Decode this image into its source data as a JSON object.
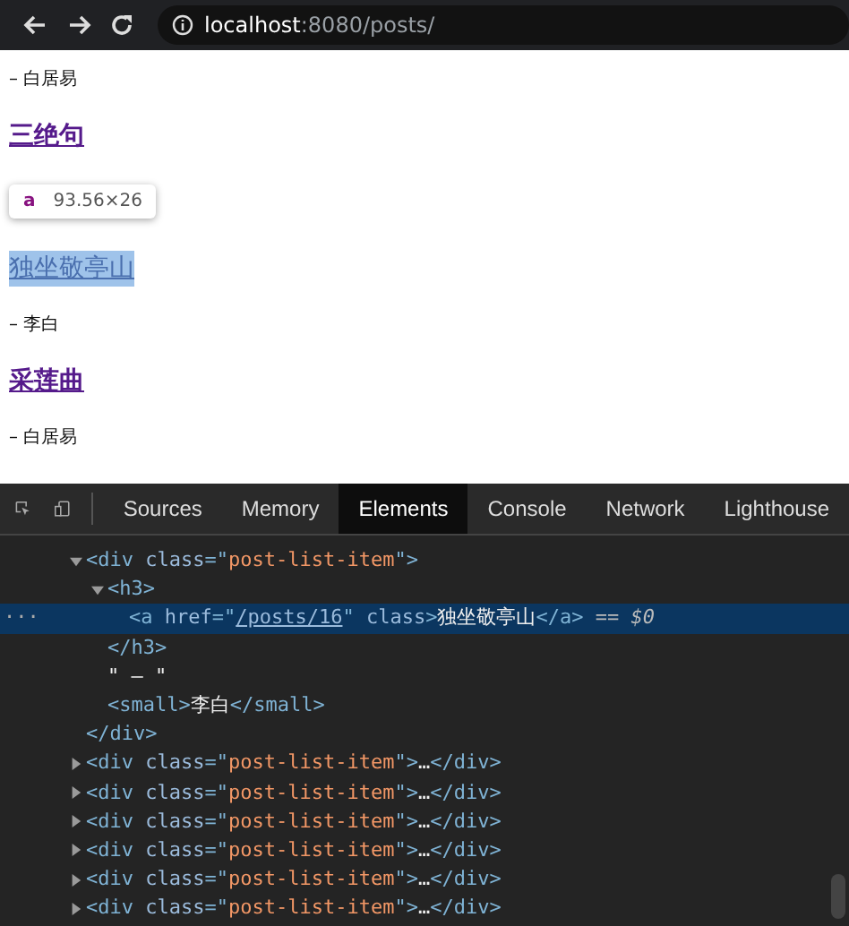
{
  "browser": {
    "url_host": "localhost",
    "url_path": ":8080/posts/"
  },
  "page": {
    "items": [
      {
        "kind": "author",
        "text": "– 白居易"
      },
      {
        "kind": "title",
        "text": "三绝句",
        "highlighted": false
      },
      {
        "kind": "title",
        "text": "独坐敬亭山",
        "highlighted": true
      },
      {
        "kind": "author",
        "text": "– 李白"
      },
      {
        "kind": "title",
        "text": "采莲曲",
        "highlighted": false
      },
      {
        "kind": "author",
        "text": "– 白居易"
      }
    ],
    "tooltip": {
      "tag": "a",
      "size": "93.56×26"
    }
  },
  "devtools": {
    "tabs": [
      {
        "label": "Sources",
        "selected": false
      },
      {
        "label": "Memory",
        "selected": false
      },
      {
        "label": "Elements",
        "selected": true
      },
      {
        "label": "Console",
        "selected": false
      },
      {
        "label": "Network",
        "selected": false
      },
      {
        "label": "Lighthouse",
        "selected": false
      }
    ],
    "tree": [
      {
        "expanded": true,
        "selected": false,
        "open": [
          {
            "kind": "tag",
            "text": "<div "
          },
          {
            "kind": "attr",
            "text": "class"
          },
          {
            "kind": "tag",
            "text": "=\""
          },
          {
            "kind": "value",
            "text": "post-list-item"
          },
          {
            "kind": "tag",
            "text": "\">"
          }
        ],
        "close": [
          {
            "kind": "tag",
            "text": "</div>"
          }
        ],
        "children": [
          {
            "expanded": true,
            "selected": false,
            "open": [
              {
                "kind": "tag",
                "text": "<h3>"
              }
            ],
            "close": [
              {
                "kind": "tag",
                "text": "</h3>"
              }
            ],
            "children": [
              {
                "selected": true,
                "gutter": "···",
                "open": [
                  {
                    "kind": "tag",
                    "text": "<a "
                  },
                  {
                    "kind": "attr",
                    "text": "href"
                  },
                  {
                    "kind": "tag",
                    "text": "=\""
                  },
                  {
                    "kind": "link",
                    "text": "/posts/16"
                  },
                  {
                    "kind": "tag",
                    "text": "\" "
                  },
                  {
                    "kind": "attr",
                    "text": "class"
                  },
                  {
                    "kind": "tag",
                    "text": ">"
                  },
                  {
                    "kind": "text",
                    "text": "独坐敬亭山"
                  },
                  {
                    "kind": "tag",
                    "text": "</a>"
                  },
                  {
                    "kind": "note",
                    "text": " == $0"
                  }
                ]
              }
            ]
          },
          {
            "selected": false,
            "open": [
              {
                "kind": "text",
                "text": "\" – \""
              }
            ]
          },
          {
            "selected": false,
            "open": [
              {
                "kind": "tag",
                "text": "<small>"
              },
              {
                "kind": "text",
                "text": "李白"
              },
              {
                "kind": "tag",
                "text": "</small>"
              }
            ]
          }
        ]
      },
      {
        "expanded": false,
        "selected": false,
        "open": [
          {
            "kind": "tag",
            "text": "<div "
          },
          {
            "kind": "attr",
            "text": "class"
          },
          {
            "kind": "tag",
            "text": "=\""
          },
          {
            "kind": "value",
            "text": "post-list-item"
          },
          {
            "kind": "tag",
            "text": "\">"
          },
          {
            "kind": "text",
            "text": "…"
          },
          {
            "kind": "tag",
            "text": "</div>"
          }
        ]
      },
      {
        "expanded": false,
        "selected": false,
        "open": [
          {
            "kind": "tag",
            "text": "<div "
          },
          {
            "kind": "attr",
            "text": "class"
          },
          {
            "kind": "tag",
            "text": "=\""
          },
          {
            "kind": "value",
            "text": "post-list-item"
          },
          {
            "kind": "tag",
            "text": "\">"
          },
          {
            "kind": "text",
            "text": "…"
          },
          {
            "kind": "tag",
            "text": "</div>"
          }
        ]
      },
      {
        "expanded": false,
        "selected": false,
        "open": [
          {
            "kind": "tag",
            "text": "<div "
          },
          {
            "kind": "attr",
            "text": "class"
          },
          {
            "kind": "tag",
            "text": "=\""
          },
          {
            "kind": "value",
            "text": "post-list-item"
          },
          {
            "kind": "tag",
            "text": "\">"
          },
          {
            "kind": "text",
            "text": "…"
          },
          {
            "kind": "tag",
            "text": "</div>"
          }
        ]
      },
      {
        "expanded": false,
        "selected": false,
        "open": [
          {
            "kind": "tag",
            "text": "<div "
          },
          {
            "kind": "attr",
            "text": "class"
          },
          {
            "kind": "tag",
            "text": "=\""
          },
          {
            "kind": "value",
            "text": "post-list-item"
          },
          {
            "kind": "tag",
            "text": "\">"
          },
          {
            "kind": "text",
            "text": "…"
          },
          {
            "kind": "tag",
            "text": "</div>"
          }
        ]
      },
      {
        "expanded": false,
        "selected": false,
        "open": [
          {
            "kind": "tag",
            "text": "<div "
          },
          {
            "kind": "attr",
            "text": "class"
          },
          {
            "kind": "tag",
            "text": "=\""
          },
          {
            "kind": "value",
            "text": "post-list-item"
          },
          {
            "kind": "tag",
            "text": "\">"
          },
          {
            "kind": "text",
            "text": "…"
          },
          {
            "kind": "tag",
            "text": "</div>"
          }
        ]
      },
      {
        "expanded": false,
        "selected": false,
        "open": [
          {
            "kind": "tag",
            "text": "<div "
          },
          {
            "kind": "attr",
            "text": "class"
          },
          {
            "kind": "tag",
            "text": "=\""
          },
          {
            "kind": "value",
            "text": "post-list-item"
          },
          {
            "kind": "tag",
            "text": "\">"
          },
          {
            "kind": "text",
            "text": "…"
          },
          {
            "kind": "tag",
            "text": "</div>"
          }
        ]
      }
    ]
  }
}
